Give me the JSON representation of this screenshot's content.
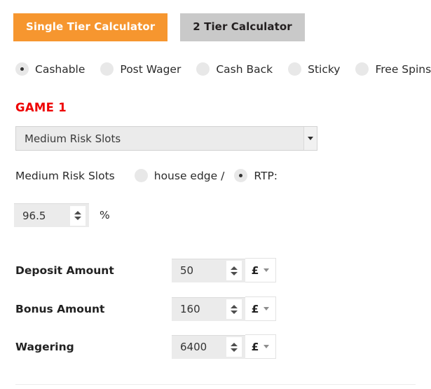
{
  "tabs": [
    {
      "label": "Single Tier Calculator",
      "active": true
    },
    {
      "label": "2 Tier Calculator",
      "active": false
    }
  ],
  "bonus_types": [
    {
      "label": "Cashable",
      "selected": true
    },
    {
      "label": "Post Wager",
      "selected": false
    },
    {
      "label": "Cash Back",
      "selected": false
    },
    {
      "label": "Sticky",
      "selected": false
    },
    {
      "label": "Free Spins",
      "selected": false
    }
  ],
  "game": {
    "heading": "GAME 1",
    "select_value": "Medium Risk Slots",
    "name_label": "Medium Risk Slots",
    "house_edge_label": "house edge /",
    "rtp_label": "RTP:",
    "house_edge_selected": false,
    "rtp_selected": true,
    "rtp_value": "96.5",
    "percent_sign": "%"
  },
  "amounts": [
    {
      "label": "Deposit Amount",
      "value": "50",
      "currency": "£"
    },
    {
      "label": "Bonus Amount",
      "value": "160",
      "currency": "£"
    },
    {
      "label": "Wagering",
      "value": "6400",
      "currency": "£"
    }
  ],
  "colors": {
    "accent_orange": "#f6962f",
    "inactive_gray": "#c9c9c9",
    "heading_red": "#ee0000",
    "field_gray": "#ebebeb"
  }
}
